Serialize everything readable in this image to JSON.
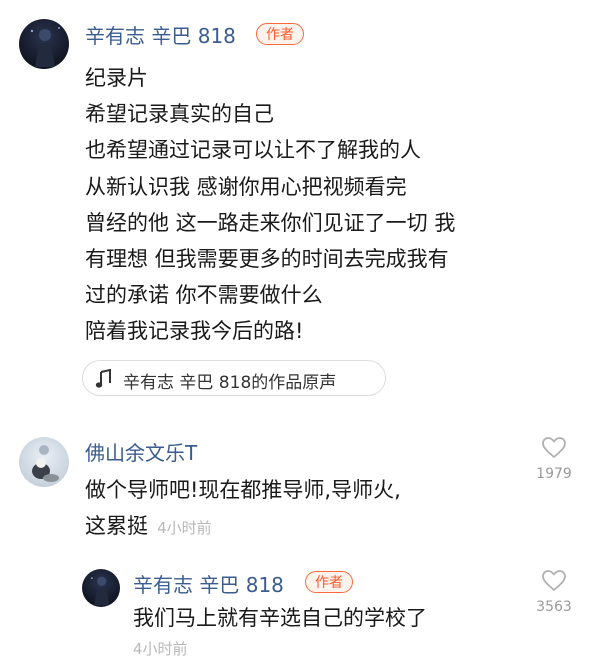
{
  "post": {
    "author": "辛有志 辛巴 818",
    "author_badge": "作者",
    "lines": [
      "纪录片",
      "希望记录真实的自己",
      "也希望通过记录可以让不了解我的人",
      "从新认识我 感谢你用心把视频看完",
      "曾经的他 这一路走来你们见证了一切 我",
      "有理想 但我需要更多的时间去完成我有",
      "过的承诺 你不需要做什么",
      "陪着我记录我今后的路!"
    ],
    "sound_label": "辛有志 辛巴 818的作品原声",
    "sound_icon": "music-note-icon"
  },
  "comment1": {
    "author": "佛山余文乐T",
    "line1": "做个导师吧!现在都推导师,导师火,",
    "line2": "这累挺",
    "time": "4小时前",
    "likes": "1979"
  },
  "reply1": {
    "author": "辛有志 辛巴 818",
    "author_badge": "作者",
    "text": "我们马上就有辛选自己的学校了",
    "time": "4小时前",
    "likes": "3563"
  },
  "colors": {
    "username": "#3a5c8f",
    "badge": "#ff5a2a",
    "timestamp": "#b8b8b8"
  }
}
